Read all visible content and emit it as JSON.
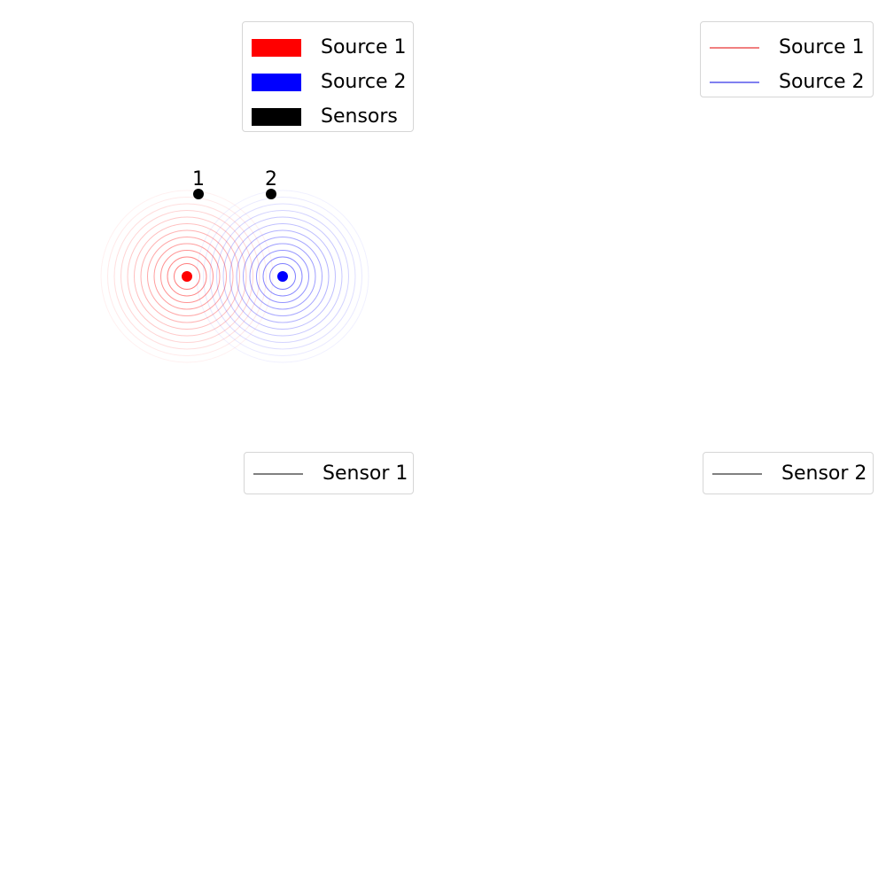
{
  "legend_sources_sensors": {
    "entries": [
      {
        "label": "Source 1",
        "color": "#ff0000"
      },
      {
        "label": "Source 2",
        "color": "#0000ff"
      },
      {
        "label": "Sensors",
        "color": "#000000"
      }
    ]
  },
  "legend_waves": {
    "entries": [
      {
        "label": "Source 1",
        "color": "#f08080"
      },
      {
        "label": "Source 2",
        "color": "#8080f0"
      }
    ]
  },
  "legend_sensor_1": {
    "label": "Sensor 1",
    "color": "#808080"
  },
  "legend_sensor_2": {
    "label": "Sensor 2",
    "color": "#808080"
  },
  "diagram": {
    "source_1_color": "#ff0000",
    "source_2_color": "#0000ff",
    "sensor_color": "#000000",
    "sensor_labels": [
      "1",
      "2"
    ]
  }
}
